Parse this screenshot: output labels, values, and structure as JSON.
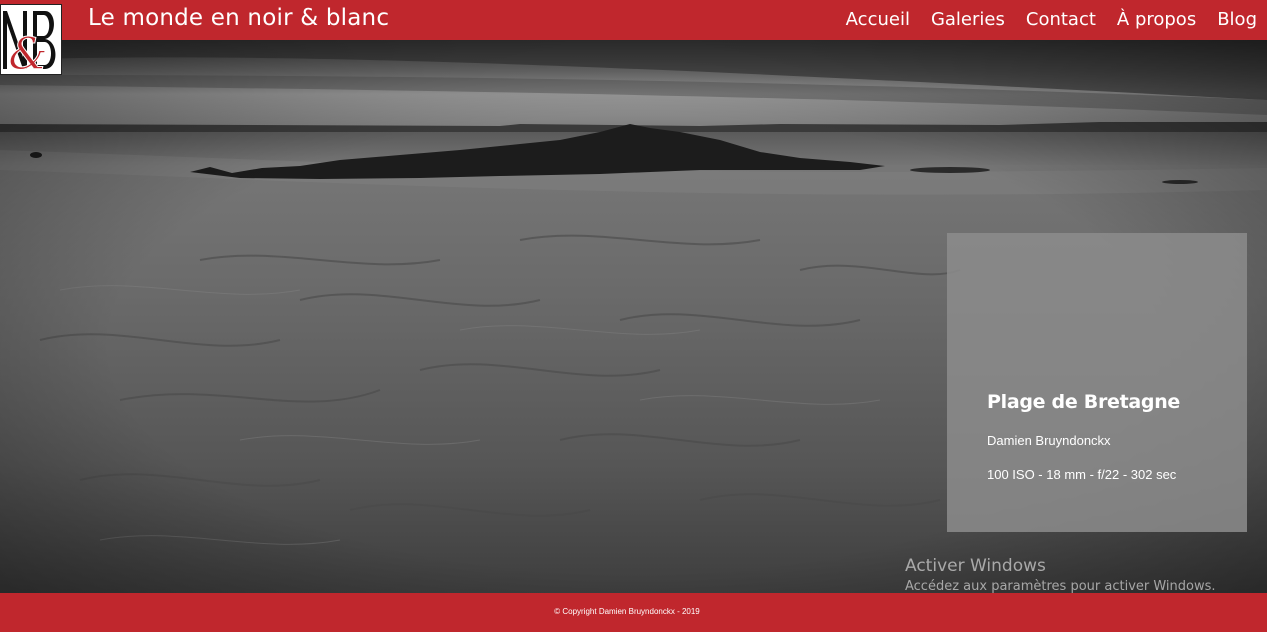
{
  "header": {
    "site_title": "Le monde en noir & blanc",
    "nav": [
      "Accueil",
      "Galeries",
      "Contact",
      "À propos",
      "Blog"
    ]
  },
  "photo": {
    "title": "Plage de Bretagne",
    "author": "Damien Bruyndonckx",
    "exif": "100 ISO - 18 mm - f/22 - 302 sec"
  },
  "windows_watermark": {
    "title": "Activer Windows",
    "subtitle": "Accédez aux paramètres pour activer Windows."
  },
  "footer": {
    "copyright": "© Copyright Damien Bruyndonckx - 2019"
  },
  "colors": {
    "brand_red": "#c0272d",
    "caption_bg": "#8c8c8c"
  }
}
